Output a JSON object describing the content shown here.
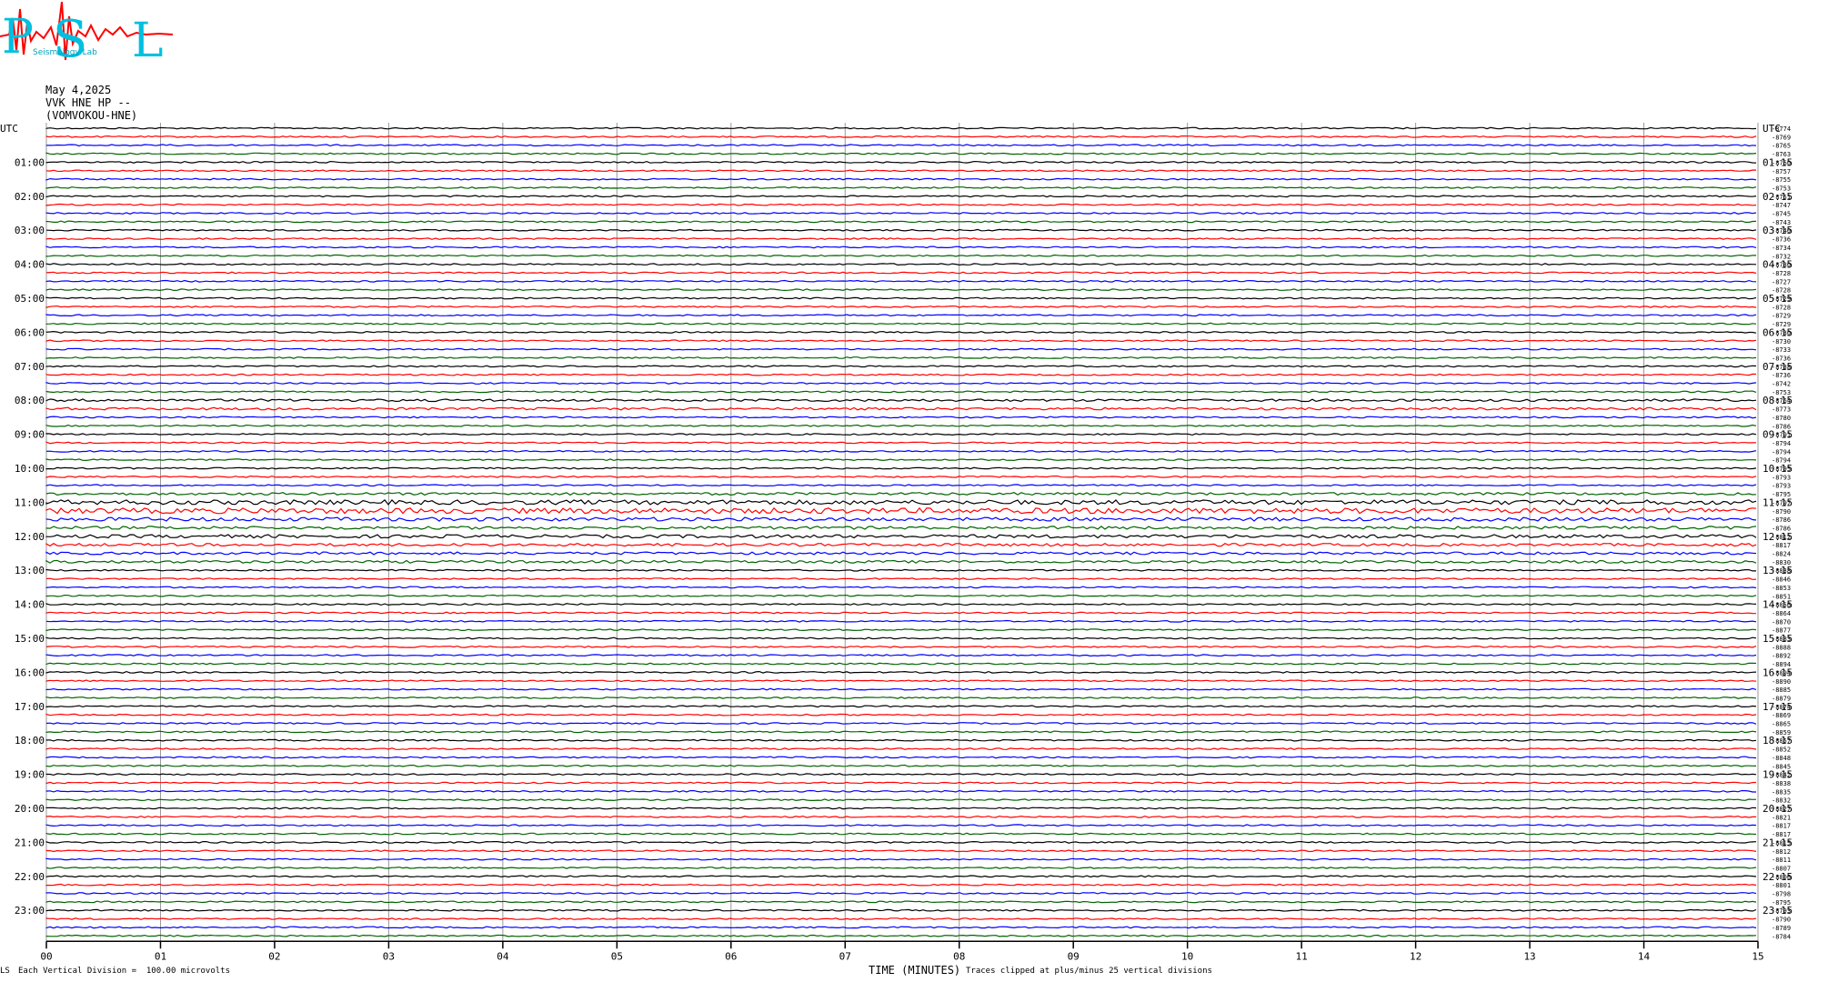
{
  "header": {
    "date": "May 4,2025",
    "station": "VVK HNE HP --",
    "location": "(VOMVOKOU-HNE)"
  },
  "logo": {
    "letters": [
      "P",
      "S",
      "L"
    ],
    "tagline": "Seismology Lab"
  },
  "footer": {
    "left_mark": "LS",
    "scale_note": "Each Vertical Division =  100.00 microvolts",
    "x_label": "TIME (MINUTES)",
    "clip_note": "Traces clipped at plus/minus 25 vertical divisions"
  },
  "colors": {
    "trace_cycle": [
      "#000000",
      "#ff0000",
      "#0000ff",
      "#006400"
    ],
    "grid": "#999999",
    "logo_text": "#00c0e0",
    "logo_wave": "#ff0000"
  },
  "chart_data": {
    "type": "line",
    "utc_label": "UTC",
    "x_ticks": [
      "00",
      "01",
      "02",
      "03",
      "04",
      "05",
      "06",
      "07",
      "08",
      "09",
      "10",
      "11",
      "12",
      "13",
      "14",
      "15"
    ],
    "xlim": [
      0,
      15
    ],
    "left_hour_labels": [
      "01:00",
      "02:00",
      "03:00",
      "04:00",
      "05:00",
      "06:00",
      "07:00",
      "08:00",
      "09:00",
      "10:00",
      "11:00",
      "12:00",
      "13:00",
      "14:00",
      "15:00",
      "16:00",
      "17:00",
      "18:00",
      "19:00",
      "20:00",
      "21:00",
      "22:00",
      "23:00"
    ],
    "right_hour_labels": [
      "01:15",
      "02:15",
      "03:15",
      "04:15",
      "05:15",
      "06:15",
      "07:15",
      "08:15",
      "09:15",
      "10:15",
      "11:15",
      "12:15",
      "13:15",
      "14:15",
      "15:15",
      "16:15",
      "17:15",
      "18:15",
      "19:15",
      "20:15",
      "21:15",
      "22:15",
      "23:15"
    ],
    "trace_count": 96,
    "trace_offsets": [
      "-8774",
      "-8769",
      "-8765",
      "-8763",
      "-8760",
      "-8757",
      "-8755",
      "-8753",
      "-8751",
      "-8747",
      "-8745",
      "-8743",
      "-8740",
      "-8736",
      "-8734",
      "-8732",
      "-8730",
      "-8728",
      "-8727",
      "-8728",
      "-8729",
      "-8728",
      "-8729",
      "-8729",
      "-8730",
      "-8730",
      "-8733",
      "-8736",
      "-8738",
      "-8736",
      "-8742",
      "-8753",
      "-8764",
      "-8773",
      "-8780",
      "-8786",
      "-8791",
      "-8794",
      "-8794",
      "-8794",
      "-8795",
      "-8793",
      "-8793",
      "-8795",
      "-8797",
      "-8790",
      "-8786",
      "-8786",
      "-8812",
      "-8817",
      "-8824",
      "-8830",
      "-8838",
      "-8846",
      "-8853",
      "-8851",
      "-8856",
      "-8864",
      "-8870",
      "-8877",
      "-8883",
      "-8888",
      "-8892",
      "-8894",
      "-8894",
      "-8890",
      "-8885",
      "-8879",
      "-8874",
      "-8869",
      "-8865",
      "-8859",
      "-8857",
      "-8852",
      "-8848",
      "-8845",
      "-8842",
      "-8838",
      "-8835",
      "-8832",
      "-8827",
      "-8821",
      "-8817",
      "-8817",
      "-8815",
      "-8812",
      "-8811",
      "-8807",
      "-8806",
      "-8801",
      "-8798",
      "-8795",
      "-8793",
      "-8790",
      "-8789",
      "-8784"
    ]
  }
}
